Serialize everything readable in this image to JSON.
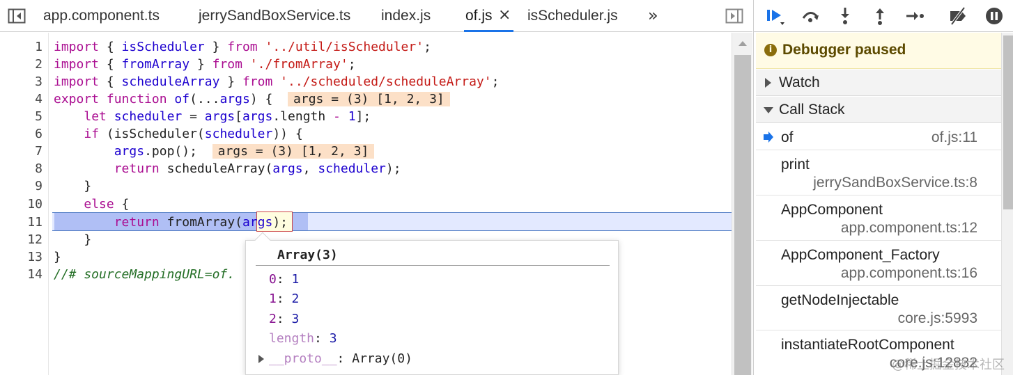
{
  "tabs": [
    {
      "label": "app.component.ts"
    },
    {
      "label": "jerrySandBoxService.ts"
    },
    {
      "label": "index.js"
    },
    {
      "label": "of.js",
      "active": true
    },
    {
      "label": "isScheduler.js"
    }
  ],
  "tab_close_glyph": "×",
  "tab_overflow_glyph": "»",
  "line_numbers": [
    "1",
    "2",
    "3",
    "4",
    "5",
    "6",
    "7",
    "8",
    "9",
    "10",
    "11",
    "12",
    "13",
    "14"
  ],
  "code": {
    "l1": {
      "kw1": "import",
      "p1": " { ",
      "id1": "isScheduler",
      "p2": " } ",
      "kw2": "from",
      "sp": " ",
      "str": "'../util/isScheduler'",
      "end": ";"
    },
    "l2": {
      "kw1": "import",
      "p1": " { ",
      "id1": "fromArray",
      "p2": " } ",
      "kw2": "from",
      "sp": " ",
      "str": "'./fromArray'",
      "end": ";"
    },
    "l3": {
      "kw1": "import",
      "p1": " { ",
      "id1": "scheduleArray",
      "p2": " } ",
      "kw2": "from",
      "sp": " ",
      "str": "'../scheduled/scheduleArray'",
      "end": ";"
    },
    "l4": {
      "kw1": "export",
      "sp1": " ",
      "kw2": "function",
      "sp2": " ",
      "fn": "of",
      "p1": "(...",
      "arg": "args",
      "p2": ") {  ",
      "inline": "args = (3) [1, 2, 3]"
    },
    "l5": {
      "indent": "    ",
      "kw": "let",
      "sp": " ",
      "v1": "scheduler",
      "p1": " = ",
      "v2": "args",
      "p2": "[",
      "v3": "args",
      "p3": ".length ",
      "op": "-",
      "sp2": " ",
      "num": "1",
      "end": "];"
    },
    "l6": {
      "indent": "    ",
      "kw": "if",
      "p1": " (isScheduler(",
      "v": "scheduler",
      "p2": ")) {"
    },
    "l7": {
      "indent": "        ",
      "v": "args",
      "p1": ".pop();  ",
      "inline": "args = (3) [1, 2, 3]"
    },
    "l8": {
      "indent": "        ",
      "kw": "return",
      "p1": " scheduleArray(",
      "v1": "args",
      "p2": ", ",
      "v2": "scheduler",
      "end": ");"
    },
    "l9": {
      "text": "    }"
    },
    "l10": {
      "indent": "    ",
      "kw": "else",
      "end": " {"
    },
    "l11": {
      "indent": "        ",
      "kw": "return",
      "p1": " fromArray(",
      "v": "args",
      "end": ");"
    },
    "l12": {
      "text": "    }"
    },
    "l13": {
      "text": "}"
    },
    "l14": {
      "text": "//# sourceMappingURL=of."
    }
  },
  "popover": {
    "title": "Array(3)",
    "items": [
      {
        "key": "0",
        "sep": ": ",
        "value": "1"
      },
      {
        "key": "1",
        "sep": ": ",
        "value": "2"
      },
      {
        "key": "2",
        "sep": ": ",
        "value": "3"
      },
      {
        "key": "length",
        "sep": ": ",
        "value": "3"
      }
    ],
    "proto": {
      "key": "__proto__",
      "sep": ": ",
      "value": "Array(0)"
    }
  },
  "sidebar": {
    "paused_label": "Debugger paused",
    "paused_icon": "i",
    "watch_label": "Watch",
    "callstack_label": "Call Stack",
    "frames": [
      {
        "fn": "of",
        "loc": "of.js:11"
      },
      {
        "fn": "print",
        "loc": "jerrySandBoxService.ts:8"
      },
      {
        "fn": "AppComponent",
        "loc": "app.component.ts:12"
      },
      {
        "fn": "AppComponent_Factory",
        "loc": "app.component.ts:16"
      },
      {
        "fn": "getNodeInjectable",
        "loc": "core.js:5993"
      },
      {
        "fn": "instantiateRootComponent",
        "loc": "core.js:12832"
      }
    ]
  },
  "watermark": "@稀土掘金技术社区",
  "colors": {
    "accent": "#1a73e8",
    "keyword": "#aa0d91",
    "string": "#c41a16",
    "identifier": "#1c00cf",
    "inline_value_bg": "#fce0c7",
    "exec_line_bg": "#e3e9ff"
  }
}
